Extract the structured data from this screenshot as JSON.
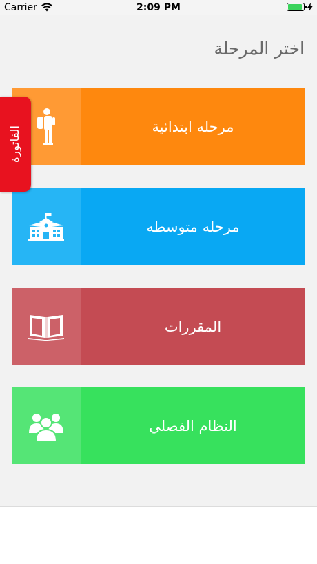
{
  "status_bar": {
    "carrier": "Carrier",
    "time": "2:09 PM",
    "battery_level": 0.9
  },
  "page": {
    "title": "اختر المرحلة"
  },
  "stages": [
    {
      "label": "مرحله ابتدائية",
      "icon": "student-backpack-icon",
      "color": "#fe880e",
      "icon_bg": "#ff9a34"
    },
    {
      "label": "مرحله متوسطه",
      "icon": "school-building-icon",
      "color": "#09a8f3",
      "icon_bg": "#26b5f5"
    },
    {
      "label": "المقررات",
      "icon": "open-book-icon",
      "color": "#c44b53",
      "icon_bg": "#cc6168"
    },
    {
      "label": "النظام الفصلي",
      "icon": "users-group-icon",
      "color": "#37e15d",
      "icon_bg": "#55e576"
    }
  ],
  "side_tab": {
    "label": "الفاتورة",
    "color": "#e8121f"
  }
}
